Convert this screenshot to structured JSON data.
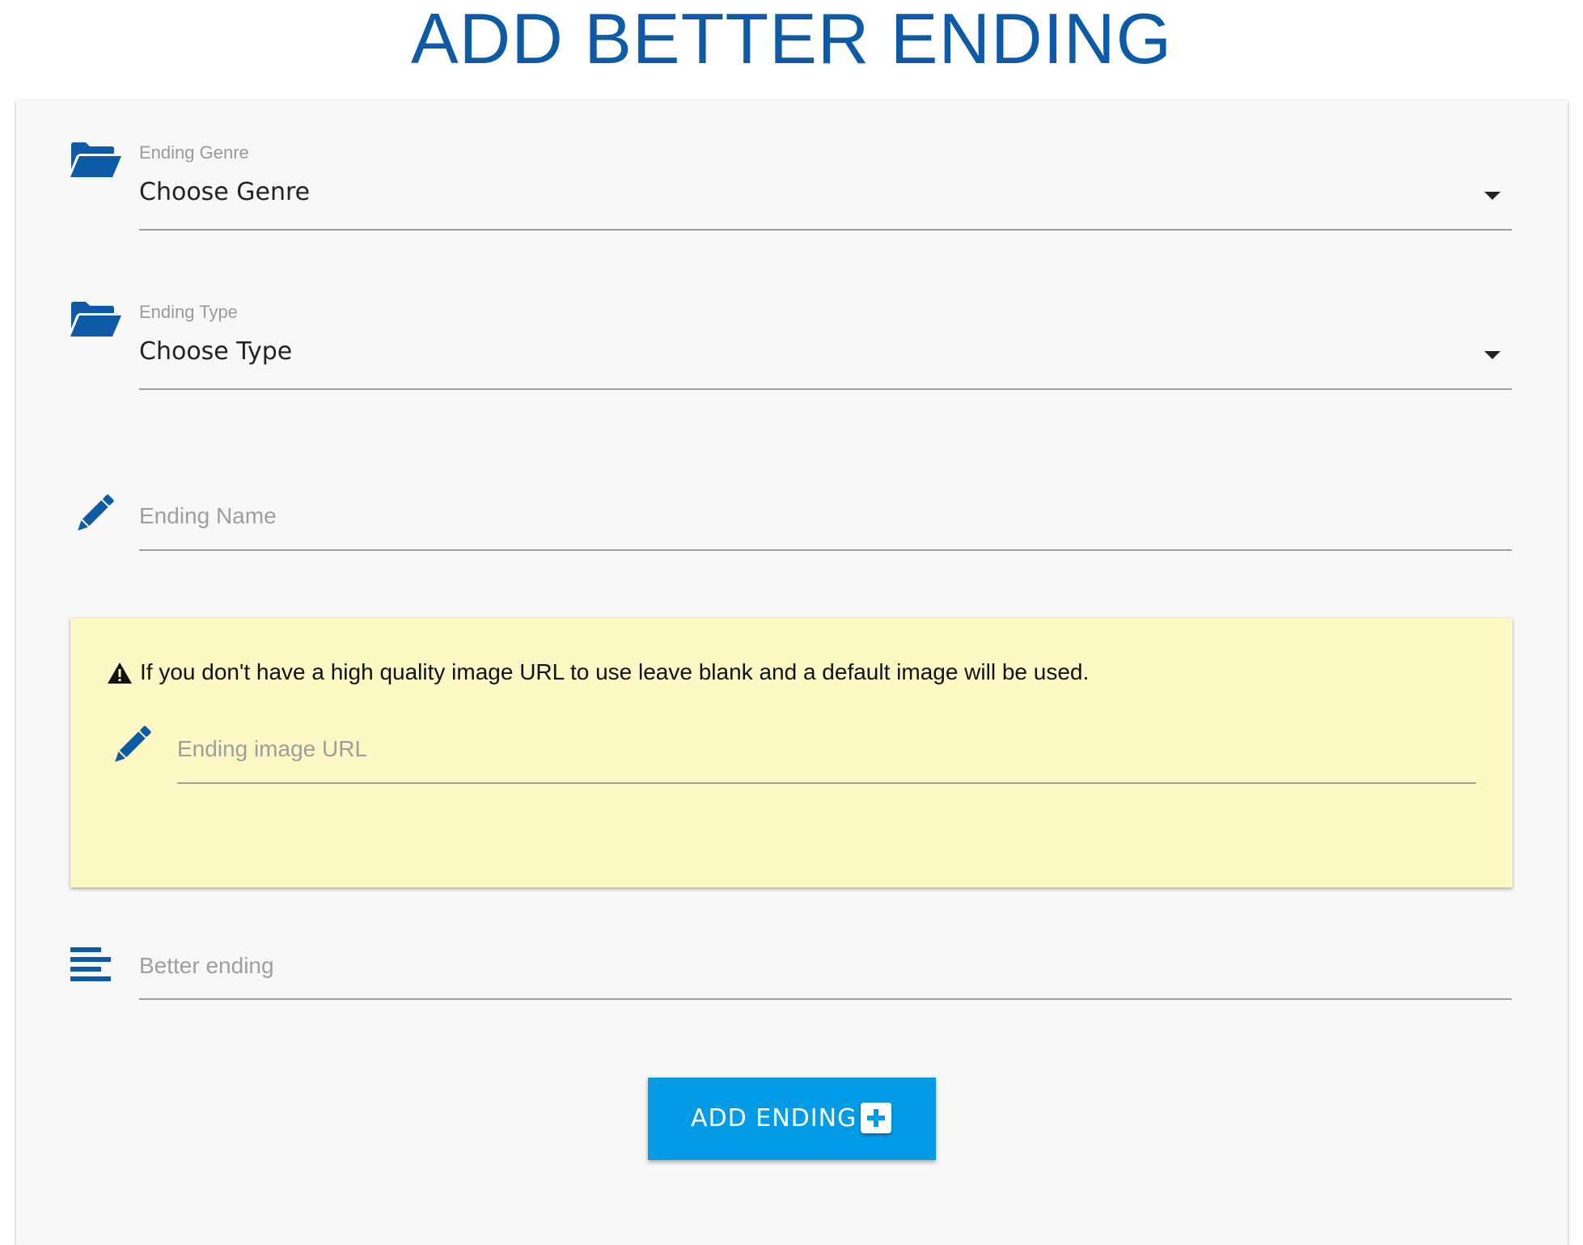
{
  "page": {
    "title": "ADD BETTER ENDING"
  },
  "form": {
    "genre": {
      "label": "Ending Genre",
      "value": "Choose Genre",
      "icon": "folder-open-icon"
    },
    "type": {
      "label": "Ending Type",
      "value": "Choose Type",
      "icon": "folder-open-icon"
    },
    "name": {
      "placeholder": "Ending Name",
      "icon": "pencil-icon"
    },
    "notice": {
      "message": "If you don't have a high quality image URL to use leave blank and a default image will be used.",
      "icon": "warning-icon",
      "image_url_placeholder": "Ending image URL",
      "image_url_icon": "pencil-icon"
    },
    "better_ending": {
      "placeholder": "Better ending",
      "icon": "align-left-icon"
    },
    "submit": {
      "label": "ADD ENDING",
      "icon": "plus-square-icon"
    }
  },
  "colors": {
    "brand_blue": "#0d5aa7",
    "button_blue": "#039be5",
    "notice_yellow": "#fef9c4",
    "card_background": "#f8f8f8"
  }
}
